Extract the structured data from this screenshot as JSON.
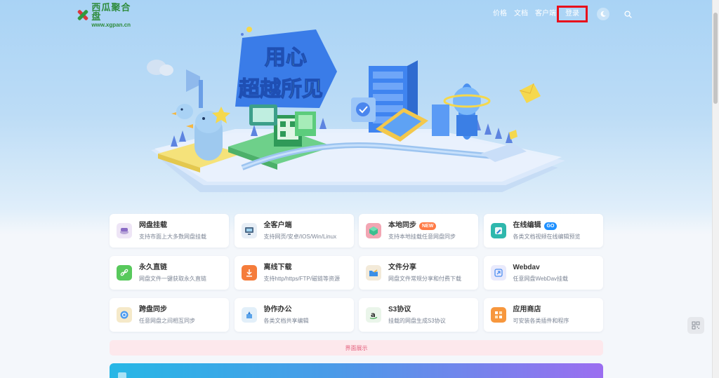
{
  "header": {
    "logo_title": "西瓜聚合盘",
    "logo_url": "www.xgpan.cn",
    "nav": [
      {
        "label": "价格"
      },
      {
        "label": "文档"
      },
      {
        "label": "客户端"
      }
    ],
    "login_label": "登录"
  },
  "hero": {
    "slogan_line1": "用心",
    "slogan_line2": "超越所见"
  },
  "features": [
    {
      "title": "网盘挂载",
      "desc": "支持市面上大多数网盘挂载",
      "icon": "drive-mount-icon",
      "color": "#eee5f6"
    },
    {
      "title": "全客户端",
      "desc": "支持网页/安卓/IOS/Win/Linux",
      "icon": "multi-client-icon",
      "color": "#e7eef6"
    },
    {
      "title": "本地同步",
      "badge": "NEW",
      "desc": "支持本地挂载任意网盘同步",
      "icon": "local-sync-icon",
      "color": "#f2a6b3"
    },
    {
      "title": "在线编辑",
      "badge": "GO",
      "desc": "各类文档视频在线编辑预览",
      "icon": "online-edit-icon",
      "color": "#2fb8ad"
    },
    {
      "title": "永久直链",
      "desc": "网盘文件一键获取永久直链",
      "icon": "link-icon",
      "color": "#58c95c"
    },
    {
      "title": "离线下载",
      "desc": "支持http/https/FTP/磁链等资源",
      "icon": "download-icon",
      "color": "#f57c3b"
    },
    {
      "title": "文件分享",
      "desc": "网盘文件常规分享和付费下载",
      "icon": "folder-share-icon",
      "color": "#f3ead9"
    },
    {
      "title": "Webdav",
      "desc": "任意网盘WebDav挂载",
      "icon": "webdav-icon",
      "color": "#e9eafc"
    },
    {
      "title": "跨盘同步",
      "desc": "任意网盘之间相互同步",
      "icon": "cross-sync-icon",
      "color": "#f5e9c9"
    },
    {
      "title": "协作办公",
      "desc": "各类文档共享编辑",
      "icon": "collab-icon",
      "color": "#e2eff9"
    },
    {
      "title": "S3协议",
      "desc": "挂载的网盘生成S3协议",
      "icon": "amazon-s3-icon",
      "color": "#eaf5ea"
    },
    {
      "title": "应用商店",
      "desc": "可安装各类插件和程序",
      "icon": "app-store-icon",
      "color": "#f7973d"
    }
  ],
  "show_bar_label": "界面展示",
  "colors": {
    "accent": "#1e90ff",
    "login_highlight": "#e8101c",
    "logo_green": "#2e8b3c"
  }
}
